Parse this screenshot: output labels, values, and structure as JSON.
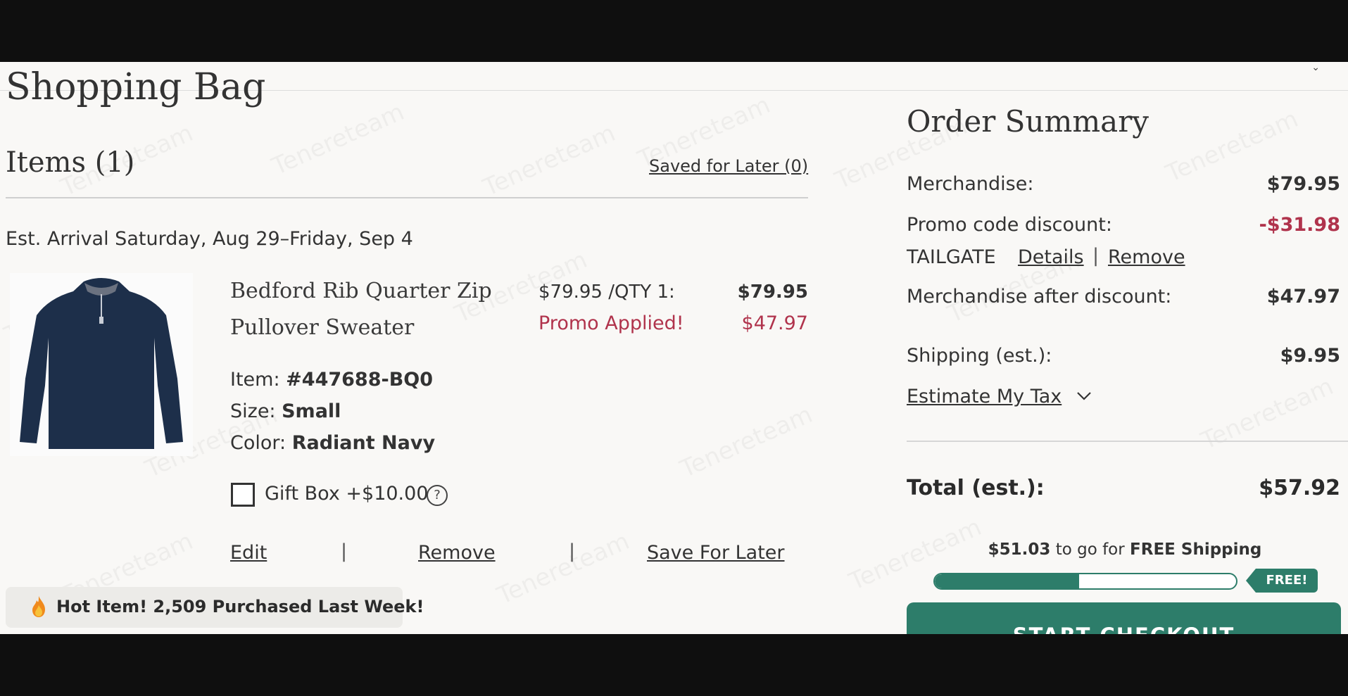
{
  "page": {
    "title": "Shopping Bag"
  },
  "items_header": {
    "title": "Items (1)",
    "saved_for_later": "Saved for Later (0)"
  },
  "delivery": {
    "est_arrival": "Est. Arrival Saturday, Aug 29–Friday, Sep 4"
  },
  "product": {
    "name": "Bedford Rib Quarter Zip Pullover Sweater",
    "unit_price_qty": "$79.95 /QTY 1:",
    "line_price": "$79.95",
    "promo_label": "Promo Applied!",
    "promo_price": "$47.97",
    "item_label": "Item: ",
    "item_value": "#447688-BQ0",
    "size_label": "Size: ",
    "size_value": "Small",
    "color_label": "Color: ",
    "color_value": "Radiant Navy",
    "gift_box_label": "Gift Box +$10.00",
    "gift_box_checked": false,
    "help_glyph": "?",
    "image_color": "#1d2f4a"
  },
  "actions": {
    "edit": "Edit",
    "remove": "Remove",
    "save_for_later": "Save For Later",
    "separator": "|"
  },
  "hot_item": {
    "text": "Hot Item! 2,509 Purchased Last Week!",
    "icon": "fire-icon"
  },
  "summary": {
    "title": "Order Summary",
    "merchandise_label": "Merchandise:",
    "merchandise_value": "$79.95",
    "promo_label": "Promo code discount:",
    "promo_value": "-$31.98",
    "promo_code": "TAILGATE",
    "details_link": "Details",
    "remove_link": "Remove",
    "separator": "|",
    "after_discount_label": "Merchandise after discount:",
    "after_discount_value": "$47.97",
    "shipping_label": "Shipping (est.):",
    "shipping_value": "$9.95",
    "estimate_tax": "Estimate My Tax",
    "total_label": "Total (est.):",
    "total_value": "$57.92"
  },
  "shipping_progress": {
    "amount": "$51.03",
    "middle_text": " to go for ",
    "emphasis": "FREE Shipping",
    "progress_fraction": 0.48,
    "badge": "FREE!"
  },
  "checkout": {
    "label": "START CHECKOUT"
  },
  "watermark_text": "Tenereteam",
  "colors": {
    "accent": "#2d7d6a",
    "promo": "#b0334c",
    "background": "#f9f8f6"
  }
}
